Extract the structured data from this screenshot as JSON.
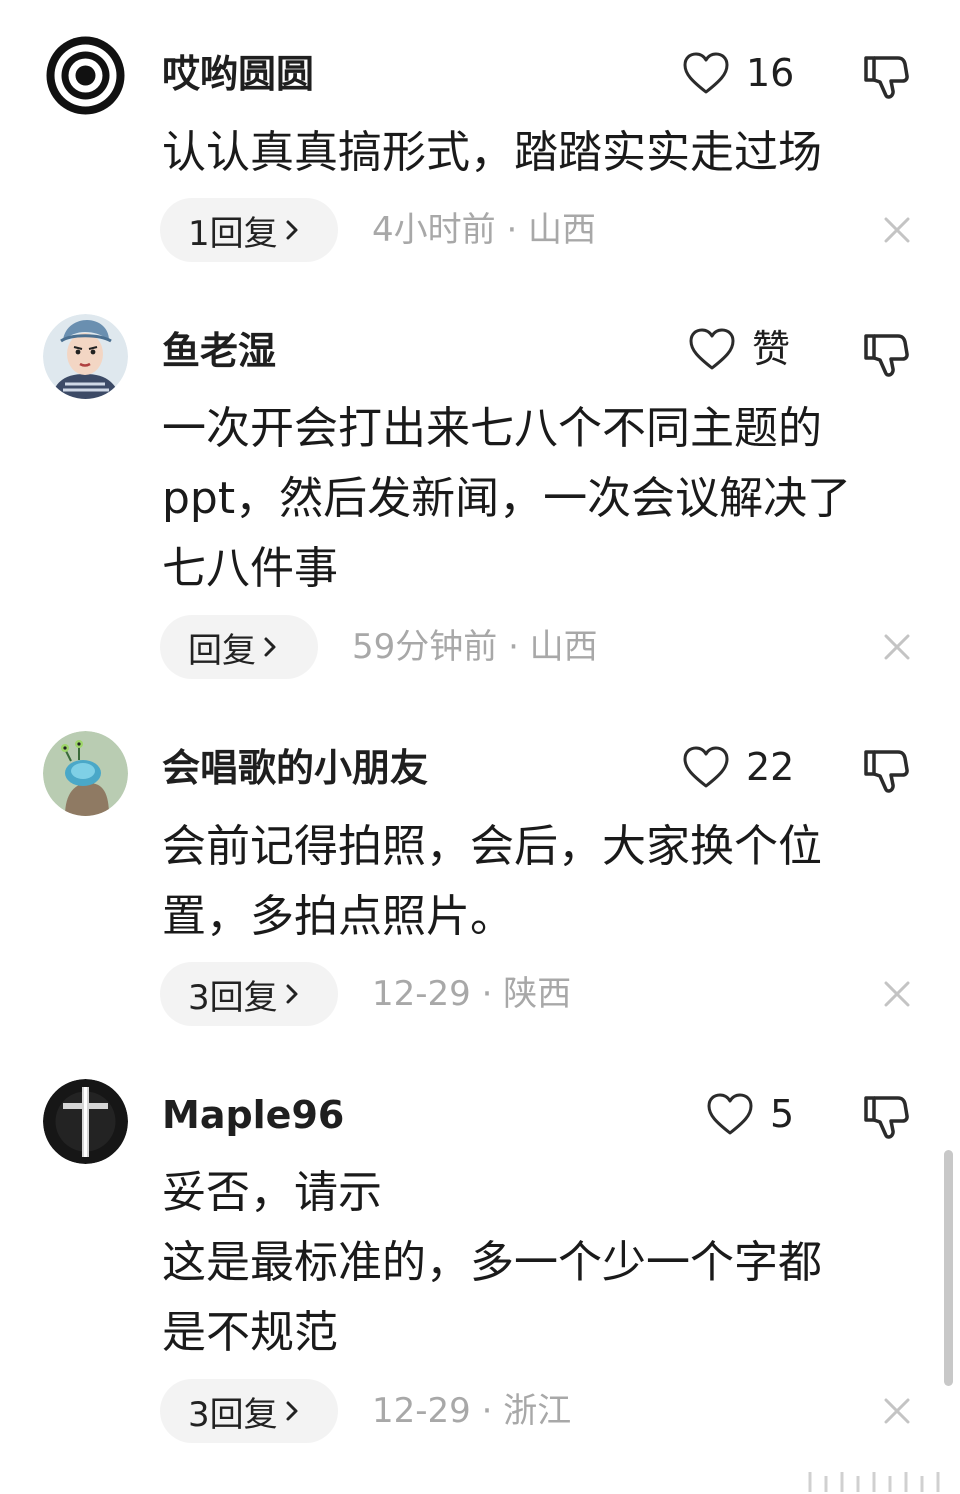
{
  "comments": [
    {
      "username": "哎哟圆圆",
      "like_count": "16",
      "text": "认认真真搞形式，踏踏实实走过场",
      "reply_label": "1回复",
      "meta": "4小时前 · 山西",
      "avatar": "concentric-circles-avatar"
    },
    {
      "username": "鱼老湿",
      "like_count": "赞",
      "text": "一次开会打出来七八个不同主题的\nppt，然后发新闻，一次会议解决了\n七八件事",
      "reply_label": "回复",
      "meta": "59分钟前 · 山西",
      "avatar": "cartoon-character-avatar"
    },
    {
      "username": "会唱歌的小朋友",
      "like_count": "22",
      "text": "会前记得拍照，会后，大家换个位\n置，多拍点照片。",
      "reply_label": "3回复",
      "meta": "12-29 · 陕西",
      "avatar": "alien-snail-avatar"
    },
    {
      "username": "Maple96",
      "like_count": "5",
      "text": "妥否，请示\n这是最标准的，多一个少一个字都\n是不规范",
      "reply_label": "3回复",
      "meta": "12-29 · 浙江",
      "avatar": "dark-cross-avatar"
    }
  ],
  "icons": {
    "like": "heart-outline-icon",
    "dislike": "thumbs-down-outline-icon",
    "close": "close-x-icon",
    "chevron": "chevron-right-icon"
  },
  "colors": {
    "text": "#1a1a1a",
    "meta": "#a8a8a8",
    "reply_bg": "#f3f3f3",
    "icon": "#2b2b2b",
    "close": "#c4c4c4"
  }
}
